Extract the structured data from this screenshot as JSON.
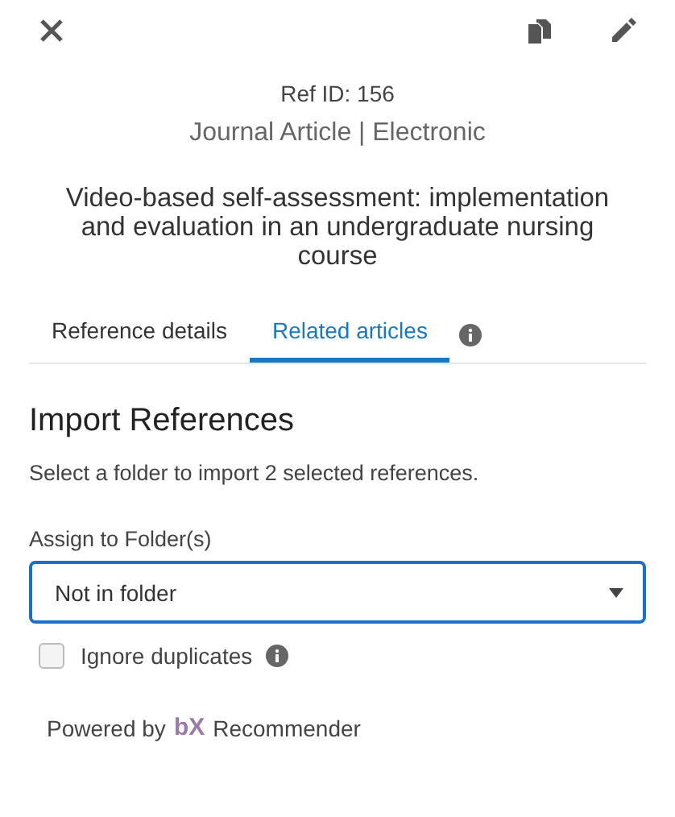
{
  "ref_id": "Ref ID: 156",
  "type_line": "Journal Article | Electronic",
  "title": "Video-based self-assessment: implementation and evaluation in an undergraduate nursing course",
  "tabs": [
    {
      "label": "Reference details",
      "selected": false
    },
    {
      "label": "Related articles",
      "selected": true
    }
  ],
  "import": {
    "heading": "Import References",
    "description": "Select a folder to import 2 selected references.",
    "folder_label": "Assign to Folder(s)",
    "folder_value": "Not in folder",
    "ignore_duplicates": {
      "label": "Ignore duplicates",
      "checked": false
    }
  },
  "footer": {
    "prefix": "Powered by",
    "logo": "bX",
    "suffix": "Recommender"
  }
}
